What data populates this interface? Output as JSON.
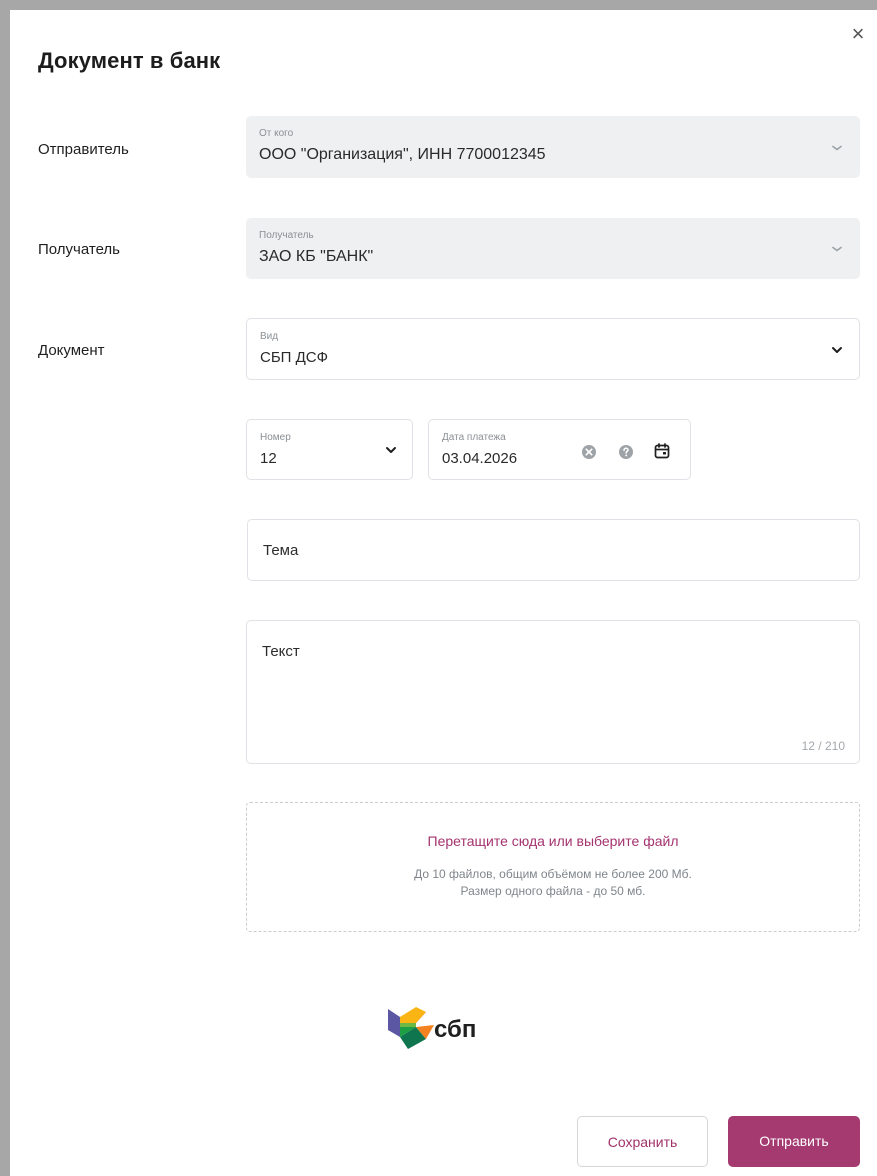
{
  "dialog": {
    "title": "Документ в банк",
    "close_glyph": "×"
  },
  "sender": {
    "label": "Отправитель",
    "caption": "От кого",
    "value": "ООО \"Организация\", ИНН 7700012345"
  },
  "recipient": {
    "label": "Получатель",
    "caption": "Получатель",
    "value": "ЗАО КБ \"БАНК\""
  },
  "document": {
    "label": "Документ",
    "caption": "Вид",
    "value": "СБП ДСФ"
  },
  "number": {
    "caption": "Номер",
    "value": "12"
  },
  "payment_date": {
    "caption": "Дата платежа",
    "value": "03.04.2026"
  },
  "subject": {
    "placeholder": "Тема"
  },
  "text": {
    "placeholder": "Текст",
    "counter": "12 / 210"
  },
  "dropzone": {
    "link_text": "Перетащите сюда или выберите файл",
    "hint_line1": "До 10 файлов, общим объёмом не более 200 Мб.",
    "hint_line2": "Размер одного файла - до 50 мб."
  },
  "logo": {
    "text": "сбп"
  },
  "buttons": {
    "save": "Сохранить",
    "send": "Отправить"
  },
  "colors": {
    "accent": "#a43a70",
    "field_bg": "#eef0f2"
  },
  "icons": {
    "close": "close-icon",
    "chevron": "chevron-down-icon",
    "clear": "clear-icon",
    "help": "help-icon",
    "calendar": "calendar-icon"
  }
}
